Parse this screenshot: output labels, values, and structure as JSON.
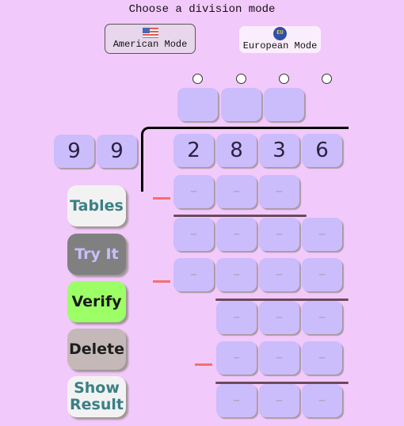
{
  "header": {
    "title": "Choose a division mode"
  },
  "modes": [
    {
      "label": "American Mode",
      "icon": "us-flag-icon",
      "selected": true
    },
    {
      "label": "European Mode",
      "icon": "eu-flag-icon",
      "selected": false
    }
  ],
  "divisor": [
    "9",
    "9"
  ],
  "dividend": [
    "2",
    "8",
    "3",
    "6"
  ],
  "quotient": [
    "",
    "",
    ""
  ],
  "work_rows": [
    {
      "cells": [
        "–",
        "–",
        "–"
      ]
    },
    {
      "cells": [
        "–",
        "–",
        "–",
        "–"
      ]
    },
    {
      "cells": [
        "–",
        "–",
        "–",
        "–"
      ]
    },
    {
      "cells": [
        "–",
        "–",
        "–"
      ]
    },
    {
      "cells": [
        "–",
        "–",
        "–"
      ]
    },
    {
      "cells": [
        "–",
        "–",
        "–"
      ]
    }
  ],
  "buttons": {
    "tables": "Tables",
    "try_it": "Try It",
    "verify": "Verify",
    "delete": "Delete",
    "show_result_line1": "Show",
    "show_result_line2": "Result"
  },
  "colors": {
    "background": "#f2c9fb",
    "digit_box": "#cbbcfc",
    "minus_sign": "#f46f6f",
    "verify": "#9cff66",
    "try_it": "#808080",
    "delete": "#c4b8b8",
    "tables": "#f2f2f2"
  }
}
